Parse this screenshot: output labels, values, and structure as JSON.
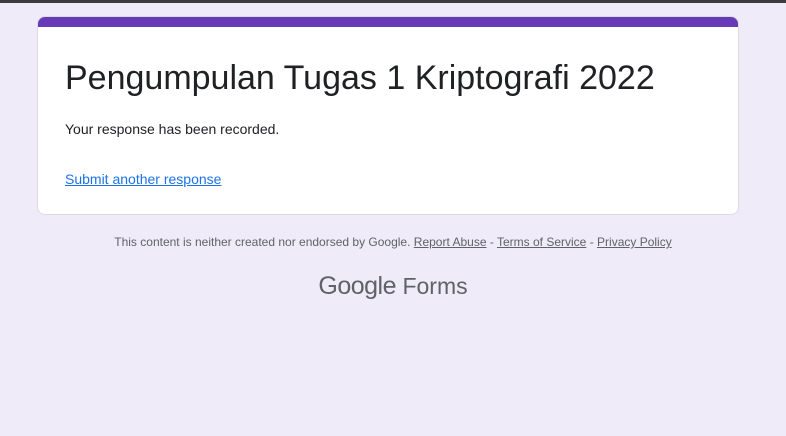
{
  "form": {
    "title": "Pengumpulan Tugas 1 Kriptografi 2022",
    "confirmation": "Your response has been recorded.",
    "another_response_link": "Submit another response"
  },
  "footer": {
    "disclaimer": "This content is neither created nor endorsed by Google.",
    "report_abuse": "Report Abuse",
    "separator": "-",
    "terms": "Terms of Service",
    "privacy": "Privacy Policy"
  },
  "branding": {
    "google": "Google",
    "forms": "Forms"
  },
  "colors": {
    "accent": "#673ab7",
    "background": "#efebf8",
    "link": "#1a73e8"
  }
}
